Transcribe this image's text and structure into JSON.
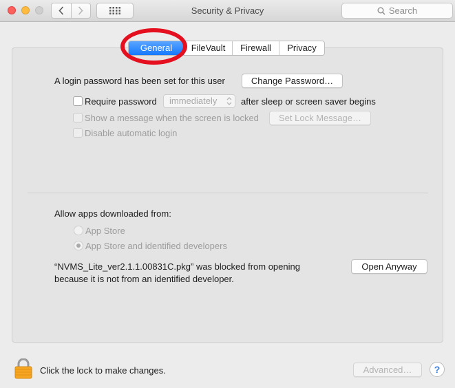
{
  "window": {
    "title": "Security & Privacy",
    "search_placeholder": "Search"
  },
  "tabs": [
    "General",
    "FileVault",
    "Firewall",
    "Privacy"
  ],
  "general": {
    "login_password_text": "A login password has been set for this user",
    "change_password_label": "Change Password…",
    "require_password_label": "Require password",
    "require_password_delay": "immediately",
    "after_sleep_text": "after sleep or screen saver begins",
    "show_message_label": "Show a message when the screen is locked",
    "set_lock_message_label": "Set Lock Message…",
    "disable_auto_login_label": "Disable automatic login"
  },
  "downloads": {
    "heading": "Allow apps downloaded from:",
    "options": [
      "App Store",
      "App Store and identified developers"
    ],
    "blocked_line1": "“NVMS_Lite_ver2.1.1.00831C.pkg” was blocked from opening",
    "blocked_line2": "because it is not from an identified developer.",
    "open_anyway_label": "Open Anyway"
  },
  "footer": {
    "lock_text": "Click the lock to make changes.",
    "advanced_label": "Advanced…",
    "help_label": "?"
  },
  "colors": {
    "accent": "#1579ff",
    "annotation": "#e5101f",
    "lock": "#f5a623"
  }
}
